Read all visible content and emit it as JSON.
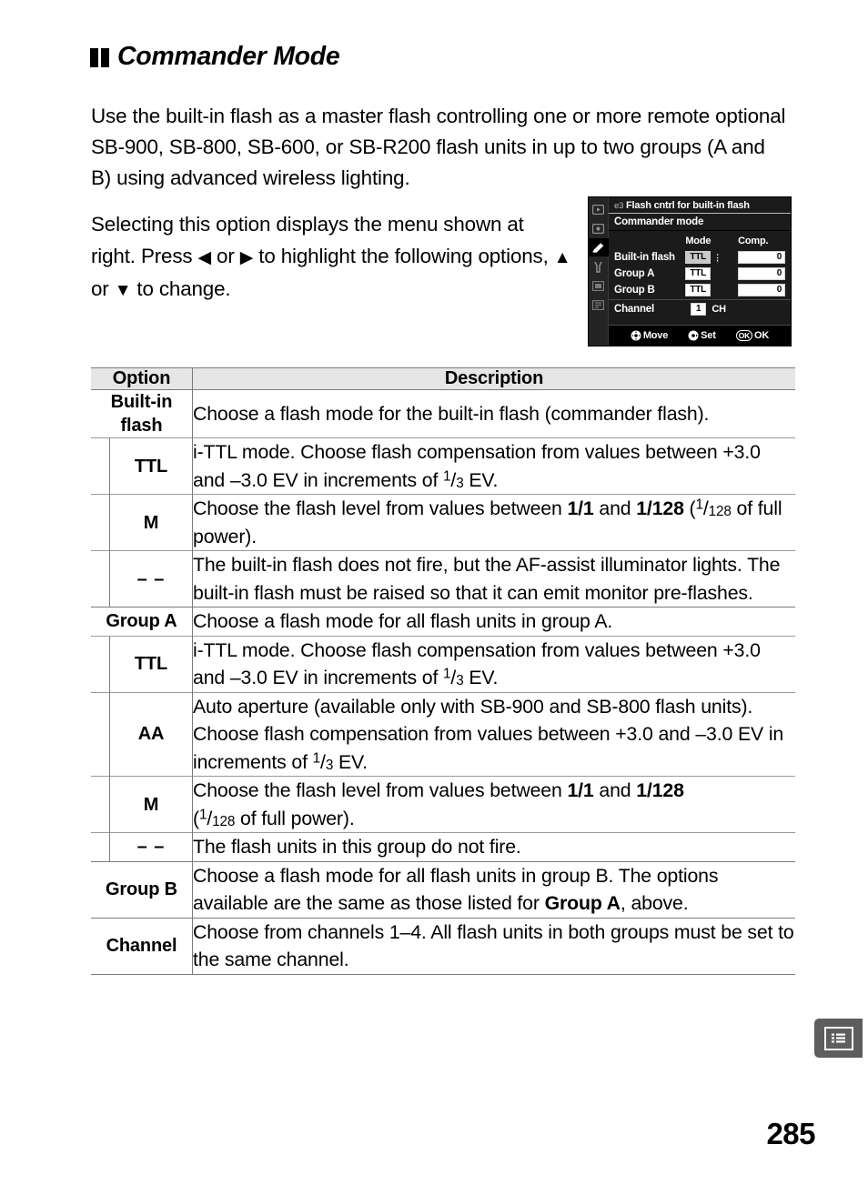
{
  "heading": {
    "icon": "two-black-squares-icon",
    "title": "Commander Mode"
  },
  "intro_paragraph": "Use the built-in flash as a master flash controlling one or more remote optional SB-900, SB-800, SB-600, or SB-R200 flash units in up to two groups (A and B) using advanced wireless lighting.",
  "sub_paragraph": {
    "part1": "Selecting this option displays the menu shown at right.  Press ",
    "arrow_left": "◀",
    "or1": " or ",
    "arrow_right": "▶",
    "part2": " to highlight the following options, ",
    "arrow_up": "▲",
    "or2": " or ",
    "arrow_down": "▼",
    "part3": " to change."
  },
  "lcd": {
    "menu_code": "e3",
    "title": "Flash cntrl for built-in flash",
    "subtitle": "Commander mode",
    "column_headers": {
      "mode": "Mode",
      "comp": "Comp."
    },
    "rows": [
      {
        "label": "Built-in flash",
        "mode": "TTL",
        "comp": "0",
        "selected": true
      },
      {
        "label": "Group A",
        "mode": "TTL",
        "comp": "0",
        "selected": false
      },
      {
        "label": "Group B",
        "mode": "TTL",
        "comp": "0",
        "selected": false
      }
    ],
    "channel": {
      "label": "Channel",
      "value": "1",
      "unit": "CH"
    },
    "footer": [
      {
        "icon": "multi-selector-icon",
        "label": "Move"
      },
      {
        "icon": "multi-selector-right-icon",
        "label": "Set"
      },
      {
        "icon": "ok-button-icon",
        "badge": "OK",
        "label": "OK"
      }
    ],
    "sidebar_icons": [
      "playback-menu-icon",
      "shooting-menu-icon",
      "custom-settings-menu-icon",
      "setup-menu-icon",
      "retouch-menu-icon",
      "recent-settings-menu-icon"
    ]
  },
  "table": {
    "headers": {
      "option": "Option",
      "description": "Description"
    },
    "rows": [
      {
        "id": "built-in-flash",
        "level": "top",
        "option": "Built-in flash",
        "description": "Choose a flash mode for the built-in flash (commander flash)."
      },
      {
        "id": "built-in-flash-ttl",
        "level": "sub",
        "option": "TTL",
        "description_pre": "i-TTL mode.  Choose flash compensation from values between +3.0 and –3.0 EV in increments of ",
        "fraction_num": "1",
        "fraction_den": "3",
        "description_post": " EV."
      },
      {
        "id": "built-in-flash-m",
        "level": "sub",
        "option": "M",
        "description_pre": "Choose the flash level from values between ",
        "bold1": "1/1",
        "description_mid": " and ",
        "bold2": "1/128",
        "description_line2_pre": " (",
        "fraction_num": "1",
        "fraction_den": "128",
        "description_post": " of full power)."
      },
      {
        "id": "built-in-flash-off",
        "level": "sub",
        "option": "– –",
        "description": "The built-in flash does not fire, but the AF-assist illuminator lights.  The built-in flash must be raised so that it can emit monitor pre-flashes."
      },
      {
        "id": "group-a",
        "level": "top",
        "option": "Group A",
        "description": "Choose a flash mode for all flash units in group A."
      },
      {
        "id": "group-a-ttl",
        "level": "sub",
        "option": "TTL",
        "description_pre": "i-TTL mode.  Choose flash compensation from values between +3.0 and –3.0 EV in increments of ",
        "fraction_num": "1",
        "fraction_den": "3",
        "description_post": " EV."
      },
      {
        "id": "group-a-aa",
        "level": "sub",
        "option": "AA",
        "description_pre": "Auto aperture (available only with SB-900 and SB-800 flash units).  Choose flash compensation from values between +3.0 and –3.0 EV in increments of ",
        "fraction_num": "1",
        "fraction_den": "3",
        "description_post": " EV."
      },
      {
        "id": "group-a-m",
        "level": "sub",
        "option": "M",
        "description_pre": "Choose the flash level from values between ",
        "bold1": "1/1",
        "description_mid": " and ",
        "bold2": "1/128",
        "description_line2_pre": "(",
        "fraction_num": "1",
        "fraction_den": "128",
        "description_post": " of full power)."
      },
      {
        "id": "group-a-off",
        "level": "sub",
        "option": "– –",
        "description": "The flash units in this group do not fire."
      },
      {
        "id": "group-b",
        "level": "top",
        "option": "Group B",
        "description_pre": "Choose a flash mode for all flash units in group B.  The options available are the same as those listed for ",
        "bold1": "Group A",
        "description_post": ", above."
      },
      {
        "id": "channel",
        "level": "top",
        "option": "Channel",
        "description": "Choose from channels 1–4.  All flash units in both groups must be set to the same channel."
      }
    ]
  },
  "side_tab": {
    "icon": "menu-list-icon"
  },
  "page_number": "285"
}
